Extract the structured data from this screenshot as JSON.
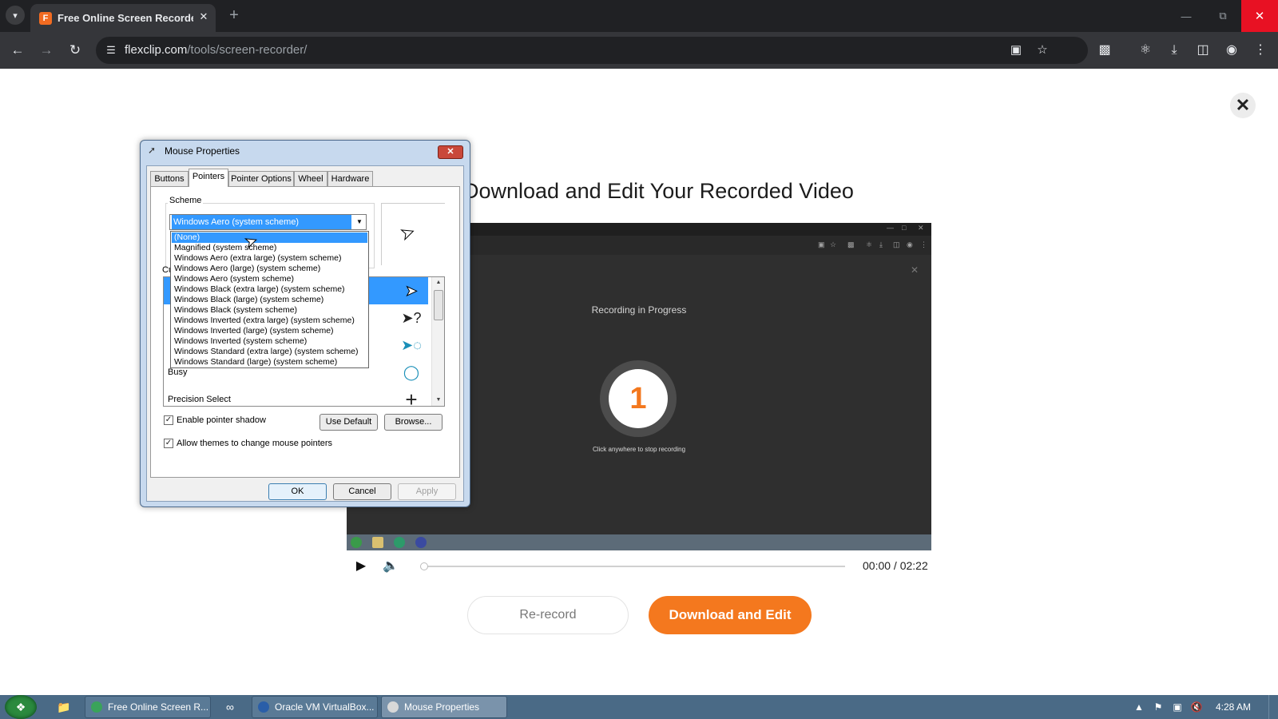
{
  "browser": {
    "tab_title": "Free Online Screen Recorder & Video Editor",
    "url_host": "flexclip.com",
    "url_path": "/tools/screen-recorder/"
  },
  "page": {
    "heading": "Download and Edit Your Recorded Video",
    "video_preview": {
      "recording_label": "Recording in Progress",
      "countdown": "1",
      "stop_hint": "Click anywhere to stop recording"
    },
    "player": {
      "time": "00:00 / 02:22",
      "progress_fraction": 0
    },
    "rerecord_label": "Re-record",
    "download_label": "Download and Edit",
    "accent_color": "#f4781e"
  },
  "dialog": {
    "title": "Mouse Properties",
    "tabs": [
      "Buttons",
      "Pointers",
      "Pointer Options",
      "Wheel",
      "Hardware"
    ],
    "active_tab": "Pointers",
    "scheme_label": "Scheme",
    "scheme_selected": "Windows Aero (system scheme)",
    "customize_label": "Customize:",
    "dropdown_options": [
      "(None)",
      "Magnified (system scheme)",
      "Windows Aero (extra large) (system scheme)",
      "Windows Aero (large) (system scheme)",
      "Windows Aero (system scheme)",
      "Windows Black (extra large) (system scheme)",
      "Windows Black (large) (system scheme)",
      "Windows Black (system scheme)",
      "Windows Inverted (extra large) (system scheme)",
      "Windows Inverted (large) (system scheme)",
      "Windows Inverted (system scheme)",
      "Windows Standard (extra large) (system scheme)",
      "Windows Standard (large) (system scheme)"
    ],
    "dropdown_highlighted": "(None)",
    "cursor_rows": [
      {
        "label": "Busy",
        "icon": "busy-cursor-icon"
      },
      {
        "label": "Precision Select",
        "icon": "crosshair-cursor-icon"
      }
    ],
    "enable_shadow_label": "Enable pointer shadow",
    "enable_shadow_checked": true,
    "allow_themes_label": "Allow themes to change mouse pointers",
    "allow_themes_checked": true,
    "use_default_label": "Use Default",
    "browse_label": "Browse...",
    "ok_label": "OK",
    "cancel_label": "Cancel",
    "apply_label": "Apply"
  },
  "taskbar": {
    "items": [
      {
        "label": "Free Online Screen R...",
        "active": false
      },
      {
        "label": "Oracle VM VirtualBox...",
        "active": false
      },
      {
        "label": "Mouse Properties",
        "active": true
      }
    ],
    "clock": "4:28 AM"
  }
}
